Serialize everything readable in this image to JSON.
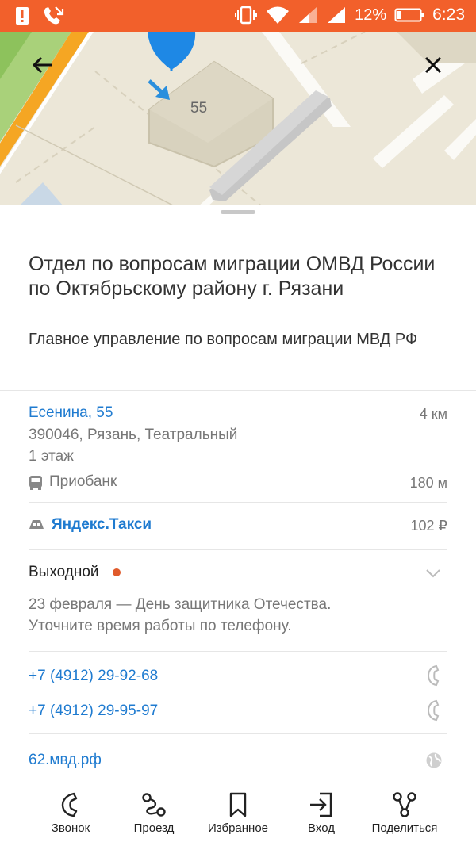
{
  "status_bar": {
    "battery_percent": "12%",
    "time": "6:23"
  },
  "map": {
    "building_number": "55"
  },
  "place": {
    "title": "Отдел по вопросам миграции ОМВД России по Октябрьскому району г. Рязани",
    "subtitle": "Главное управление по вопросам миграции МВД РФ"
  },
  "address": {
    "street": "Есенина, 55",
    "distance": "4 км",
    "line2": "390046, Рязань, Театральный",
    "line3": "1 этаж"
  },
  "transit": {
    "stop": "Приобанк",
    "distance": "180 м"
  },
  "taxi": {
    "label": "Яндекс.Такси",
    "price": "102 ₽"
  },
  "hours": {
    "status": "Выходной",
    "note_line1": "23 февраля — День защитника Отечества.",
    "note_line2": "Уточните время работы по телефону."
  },
  "phones": [
    "+7 (4912) 29-92-68",
    "+7 (4912) 29-95-97"
  ],
  "website": "62.мвд.рф",
  "bottom_bar": {
    "call": "Звонок",
    "route": "Проезд",
    "favorite": "Избранное",
    "entrance": "Вход",
    "share": "Поделиться"
  },
  "colors": {
    "status_bar": "#f2602b",
    "link": "#1f7bd0",
    "closed_dot": "#e05a2b"
  }
}
